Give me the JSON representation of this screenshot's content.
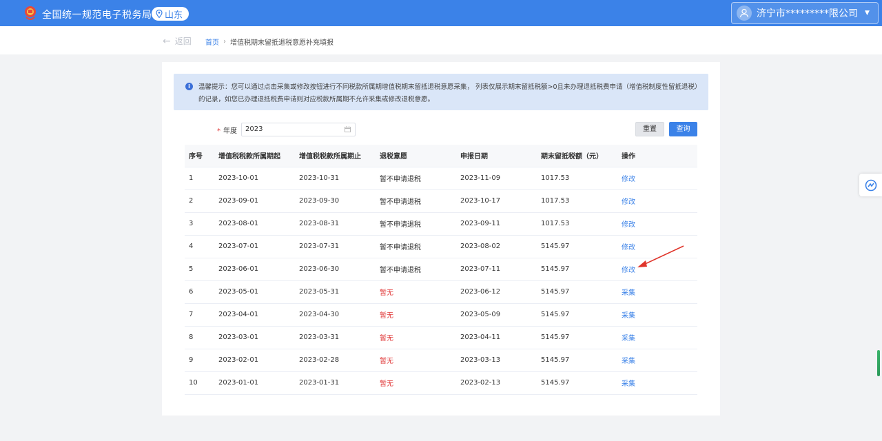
{
  "header": {
    "site_title": "全国统一规范电子税务局",
    "region": "山东",
    "user_name": "济宁市*********限公司"
  },
  "subbar": {
    "back_label": "返回",
    "breadcrumb_home": "首页",
    "breadcrumb_current": "增值税期末留抵退税意愿补充填报"
  },
  "notice": {
    "text": "温馨提示：您可以通过点击采集或修改按钮进行不同税款所属期增值税期末留抵退税意愿采集， 列表仅展示期末留抵税额>0且未办理退抵税费申请（增值税制度性留抵退税）的记录，如您已办理退抵税费申请则对应税款所属期不允许采集或修改退税意愿。"
  },
  "filter": {
    "required_mark": "*",
    "year_label": "年度",
    "year_value": "2023",
    "reset_label": "重置",
    "query_label": "查询"
  },
  "table": {
    "columns": [
      "序号",
      "增值税税款所属期起",
      "增值税税款所属期止",
      "退税意愿",
      "申报日期",
      "期末留抵税额（元）",
      "操作"
    ],
    "rows": [
      {
        "no": "1",
        "start": "2023-10-01",
        "end": "2023-10-31",
        "intent": "暂不申请退税",
        "date": "2023-11-09",
        "amount": "1017.53",
        "op": "修改"
      },
      {
        "no": "2",
        "start": "2023-09-01",
        "end": "2023-09-30",
        "intent": "暂不申请退税",
        "date": "2023-10-17",
        "amount": "1017.53",
        "op": "修改"
      },
      {
        "no": "3",
        "start": "2023-08-01",
        "end": "2023-08-31",
        "intent": "暂不申请退税",
        "date": "2023-09-11",
        "amount": "1017.53",
        "op": "修改"
      },
      {
        "no": "4",
        "start": "2023-07-01",
        "end": "2023-07-31",
        "intent": "暂不申请退税",
        "date": "2023-08-02",
        "amount": "5145.97",
        "op": "修改"
      },
      {
        "no": "5",
        "start": "2023-06-01",
        "end": "2023-06-30",
        "intent": "暂不申请退税",
        "date": "2023-07-11",
        "amount": "5145.97",
        "op": "修改"
      },
      {
        "no": "6",
        "start": "2023-05-01",
        "end": "2023-05-31",
        "intent": "暂无",
        "date": "2023-06-12",
        "amount": "5145.97",
        "op": "采集"
      },
      {
        "no": "7",
        "start": "2023-04-01",
        "end": "2023-04-30",
        "intent": "暂无",
        "date": "2023-05-09",
        "amount": "5145.97",
        "op": "采集"
      },
      {
        "no": "8",
        "start": "2023-03-01",
        "end": "2023-03-31",
        "intent": "暂无",
        "date": "2023-04-11",
        "amount": "5145.97",
        "op": "采集"
      },
      {
        "no": "9",
        "start": "2023-02-01",
        "end": "2023-02-28",
        "intent": "暂无",
        "date": "2023-03-13",
        "amount": "5145.97",
        "op": "采集"
      },
      {
        "no": "10",
        "start": "2023-01-01",
        "end": "2023-01-31",
        "intent": "暂无",
        "date": "2023-02-13",
        "amount": "5145.97",
        "op": "采集"
      }
    ]
  },
  "colors": {
    "primary": "#3b82e8",
    "status_none": "#e03a3a",
    "annotation_arrow": "#e0352b"
  }
}
